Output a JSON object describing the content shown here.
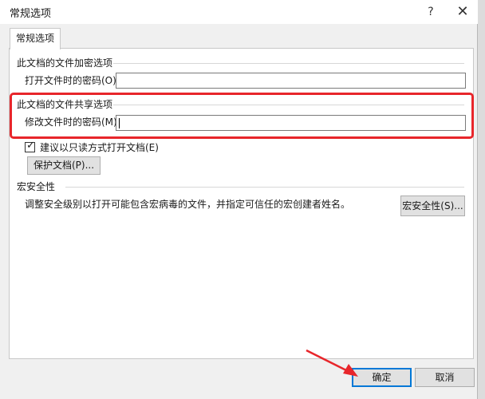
{
  "window": {
    "title": "常规选项",
    "help_glyph": "?",
    "close_glyph": "✕"
  },
  "tabs": [
    {
      "label": "常规选项"
    }
  ],
  "encryption": {
    "section_title": "此文档的文件加密选项",
    "open_password_label": "打开文件时的密码(O):",
    "open_password_value": ""
  },
  "sharing": {
    "section_title": "此文档的文件共享选项",
    "modify_password_label": "修改文件时的密码(M):",
    "modify_password_value": "",
    "read_only_label": "建议以只读方式打开文档(E)",
    "read_only_checked": true,
    "protect_button": "保护文档(P)..."
  },
  "macro": {
    "section_title": "宏安全性",
    "description": "调整安全级别以打开可能包含宏病毒的文件，并指定可信任的宏创建者姓名。",
    "button": "宏安全性(S)..."
  },
  "footer": {
    "ok_button": "确定",
    "cancel_button": "取消"
  },
  "colors": {
    "highlight": "#e8262b",
    "focus": "#0078d7"
  }
}
